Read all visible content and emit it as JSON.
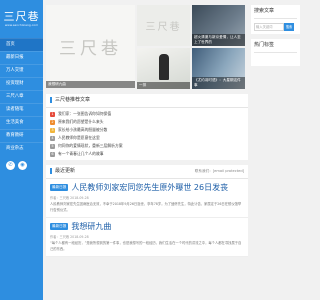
{
  "logo": {
    "title": "三尺巷",
    "url": "www.sanchixiang.com"
  },
  "nav": [
    "首页",
    "最新日报",
    "万人交馈",
    "投资理财",
    "三尺八章",
    "读者随笔",
    "生活美食",
    "教育教研",
    "商业杂志"
  ],
  "social_icons": [
    "wechat-icon",
    "weibo-icon"
  ],
  "hero": {
    "main_caption": "我想研九曲",
    "thumbs": [
      {
        "caption": ""
      },
      {
        "caption": "超火清澈与新京爱情，让人至上了世界的"
      },
      {
        "caption": "一排"
      },
      {
        "caption": "《尤约羽时语》：大星期这件事"
      }
    ]
  },
  "recommend": {
    "title": "三尺巷推荐文章",
    "items": [
      "我们家：一张图告诉你如何保值",
      "原来我们的愿望是什么来头",
      "家长给小孩最高的胆量被分散",
      "人民教师你是愿意在这里",
      "何同你的爱情现状，重新三层解析方案",
      "有一个青春让几个人的故事"
    ]
  },
  "latest": {
    "title": "最近更新",
    "subtitle": "联系我们：[email protected]",
    "articles": [
      {
        "badge": "最新日报",
        "title": "人民教师刘家宏同您先生原外曝世 26日发丧",
        "meta": "作者：三尺巷  2018-09-28",
        "excerpt": "人民教师刘家宏先生因病医治无效，不幸于2018年9月26日逝世，享年78岁。为了缅怀先生，特此讣告，家属定于26日在殡仪馆举行告别仪式。"
      },
      {
        "badge": "最新日报",
        "title": "我想研九曲",
        "meta": "作者：三尺巷  2018-09-28",
        "excerpt": "“每个人都有一段经历，”是我所想到的第一件事，也是我想写的一段经历，我们生活在一个时代的洪流之中，每个人都在寻找属于自己的东西。"
      }
    ]
  },
  "search": {
    "title": "搜索文章",
    "placeholder": "输入关键词",
    "button": "搜索"
  },
  "tags": {
    "title": "热门标签"
  }
}
